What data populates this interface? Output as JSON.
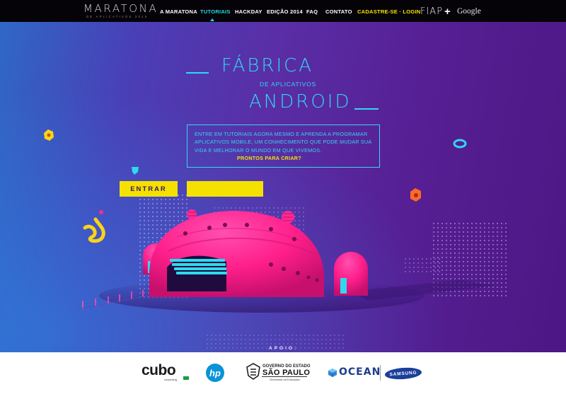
{
  "brand": {
    "title": "MARATONA",
    "subtitle": "DE APLICATIVOS 2015"
  },
  "nav": {
    "items": [
      {
        "label": "A MARATONA"
      },
      {
        "label": "TUTORIAIS"
      },
      {
        "label": "HACKDAY"
      },
      {
        "label": "EDIÇÃO 2014"
      },
      {
        "label": "FAQ"
      },
      {
        "label": "CONTATO"
      },
      {
        "label": "CADASTRE-SE · LOGIN"
      }
    ],
    "active_index": 1
  },
  "partners": {
    "fiap": "FIAP",
    "plus": "+",
    "google": "Google"
  },
  "hero": {
    "title_top": "FÁBRICA",
    "title_mid": "DE APLICATIVOS",
    "title_bottom": "ANDROID",
    "intro": "ENTRE EM TUTORIAIS AGORA MESMO E APRENDA A PROGRAMAR APLICATIVOS MOBILE, UM CONHECIMENTO QUE PODE MUDAR SUA VIDA E MELHORAR O MUNDO EM QUE VIVEMOS.",
    "cta": "PRONTOS PARA CRIAR?",
    "enter_button": "ENTRAR"
  },
  "support": {
    "label": "APOIO:",
    "cubo": "cubo",
    "cubo_sub": "coworking",
    "hp": "hp",
    "gov_line1": "GOVERNO DO ESTADO",
    "gov_line2": "SÃO PAULO",
    "gov_line3": "Secretaria da Educação",
    "ocean": "OCEAN",
    "samsung": "SAMSUNG"
  },
  "colors": {
    "accent_cyan": "#2fd9ee",
    "accent_yellow": "#f5e100",
    "dome_pink": "#ff1f8a",
    "nav_bg": "#050308"
  }
}
